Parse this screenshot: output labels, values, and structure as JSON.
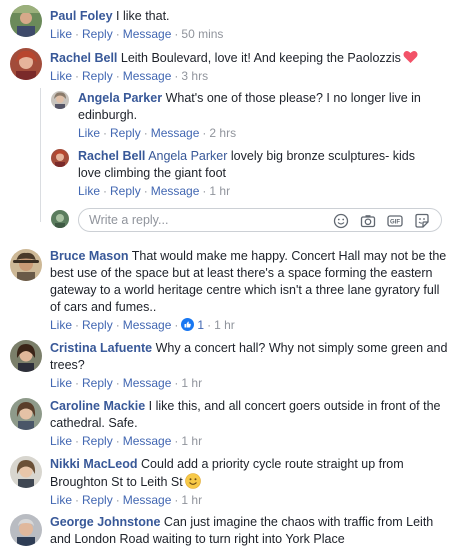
{
  "actions": {
    "like": "Like",
    "reply": "Reply",
    "message": "Message",
    "dot": "·"
  },
  "comments": [
    {
      "author": "Paul Foley",
      "text": "I like that.",
      "time": "50 mins"
    },
    {
      "author": "Rachel Bell",
      "text": "Leith Boulevard, love it! And keeping the Paolozzis",
      "emoji": "heart",
      "time": "3 hrs",
      "replies": [
        {
          "author": "Angela Parker",
          "line1": "What's one of those please? I no longer live in",
          "line2": "edinburgh.",
          "time": "2 hrs"
        },
        {
          "author": "Rachel Bell",
          "tag": "Angela Parker",
          "line1": "lovely big bronze sculptures- kids",
          "line2": "love climbing the giant foot",
          "time": "1 hr"
        }
      ]
    },
    {
      "author": "Bruce Mason",
      "line1": "That would make me happy. Concert Hall may not be the",
      "line2": "best use of the space but at least there's a space forming the eastern",
      "line3": "gateway to a world heritage centre which isn't a three lane gyratory full",
      "line4": "of cars and fumes..",
      "reaction_count": "1",
      "time": "1 hr"
    },
    {
      "author": "Cristina Lafuente",
      "line1": "Why a concert hall? Why not simply some green and",
      "line2": "trees?",
      "time": "1 hr"
    },
    {
      "author": "Caroline Mackie",
      "line1": "I like this, and all concert goers outside in front of the",
      "line2": "cathedral. Safe.",
      "time": "1 hr"
    },
    {
      "author": "Nikki MacLeod",
      "line1": "Could add a priority cycle route straight up from",
      "line2": "Broughton St to Leith St",
      "emoji": "smile",
      "time": "1 hr"
    },
    {
      "author": "George Johnstone",
      "line1": "Can just imagine the chaos with traffic from Leith",
      "line2": "and London Road waiting to turn right into York Place"
    }
  ],
  "reply_box": {
    "placeholder": "Write a reply...",
    "icons": [
      "emoji-icon",
      "camera-icon",
      "gif-icon",
      "sticker-icon"
    ]
  },
  "colors": {
    "link": "#385898",
    "action": "#4267b2",
    "meta": "#90949c",
    "heart": "#f25268",
    "like_blue": "#1877f2"
  }
}
